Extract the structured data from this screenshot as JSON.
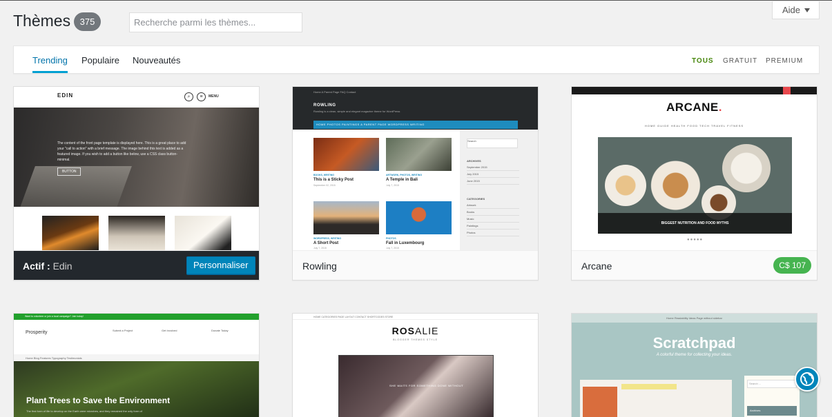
{
  "header": {
    "title": "Thèmes",
    "count": "375",
    "search_placeholder": "Recherche parmi les thèmes...",
    "help_label": "Aide"
  },
  "filters": {
    "tabs": [
      {
        "label": "Trending",
        "active": true
      },
      {
        "label": "Populaire",
        "active": false
      },
      {
        "label": "Nouveautés",
        "active": false
      }
    ],
    "price": [
      {
        "label": "Tous",
        "active": true
      },
      {
        "label": "Gratuit",
        "active": false
      },
      {
        "label": "Premium",
        "active": false
      }
    ]
  },
  "themes": [
    {
      "name": "Edin",
      "active": true,
      "active_prefix": "Actif :",
      "customize_label": "Personnaliser",
      "preview": {
        "logo": "EDIN",
        "menu": "MENU",
        "hero_text": "The content of the front page template is displayed here. This is a great place to add your \"call to action\" with a brief message. The image behind this text is added as a featured image. If you wish to add a button like below, use a CSS class button-minimal.",
        "button": "BUTTON"
      }
    },
    {
      "name": "Rowling",
      "preview": {
        "site_title": "ROWLING",
        "site_sub": "Rowling is a clean, simple and elegant magazine theme for WordPress",
        "topnav": "Home   A Parent Page   FAQ   Contact",
        "nav": "HOME   PHOTOS   PAINTINGS   A PARENT PAGE   WORDPRESS   WRITING",
        "posts": [
          {
            "meta": "BOOKS, WRITING",
            "title": "This is a Sticky Post",
            "date": "September 02, 2015"
          },
          {
            "meta": "ARTWORK, PHOTOS, WRITING",
            "title": "A Temple in Bali",
            "date": "July 7, 2015"
          },
          {
            "meta": "WORDPRESS, WRITING",
            "title": "A Short Post",
            "date": "July 7, 2015"
          },
          {
            "meta": "PHOTOS",
            "title": "Fall in Luxembourg",
            "date": "July 7, 2015"
          }
        ],
        "sidebar": {
          "search": "Search",
          "archives_title": "ARCHIVES",
          "archives": [
            "September 2015",
            "July 2015",
            "June 2015"
          ],
          "categories_title": "CATEGORIES",
          "categories": [
            "Artwork",
            "Books",
            "Music",
            "Paintings",
            "Photos"
          ]
        }
      }
    },
    {
      "name": "Arcane",
      "price": "C$ 107",
      "preview": {
        "logo": "ARCANE",
        "nav": "HOME   GUIDE   HEALTH   FOOD   TECH   TRAVEL   FITNESS",
        "caption": "BIGGEST NUTRITION AND FOOD MYTHS"
      }
    },
    {
      "name": "Prosperity",
      "preview": {
        "topbar": "Want to volunteer or join a local campaign? Join today!",
        "site_name": "Prosperity",
        "cols": [
          "Submit a Project",
          "Get Involved",
          "Donate Today"
        ],
        "nav": "Home   Blog   Features   Typography   Testimonials",
        "hero_title": "Plant Trees to Save the Environment",
        "hero_sub": "The first form of life to develop on the Earth were microbes, and they remained the only form of"
      }
    },
    {
      "name": "Rosalie",
      "preview": {
        "nav": "HOME   CATEGORIES   PAGE LAYOUT   CONTACT   SHORTCODES   STORE",
        "logo_a": "ROS",
        "logo_b": "ALIE",
        "tagline": "BLOGGER THEMES STYLE",
        "caption": "SHE WAITS FOR SOMETHING DONE WITHOUT"
      }
    },
    {
      "name": "Scratchpad",
      "preview": {
        "nav": "Home   Readability   Ideas   Page without sidebar",
        "title": "Scratchpad",
        "subtitle": "A colorful theme for collecting your ideas.",
        "search": "Search ...",
        "archives": "Archives"
      }
    }
  ],
  "colors": {
    "accent": "#0073aa",
    "tab_underline": "#00a0d2",
    "filter_active": "#46860b",
    "price_badge": "#46b450",
    "active_bar": "#23282d",
    "button": "#0085ba"
  },
  "icons": {
    "help_caret": "caret-down-icon",
    "floating": "globe-icon"
  }
}
